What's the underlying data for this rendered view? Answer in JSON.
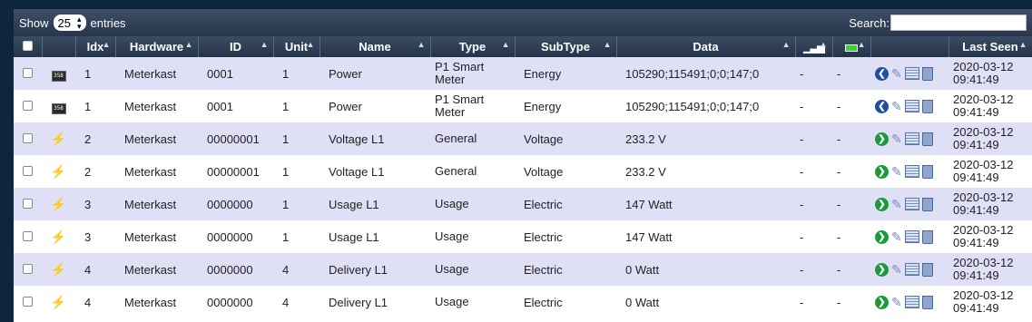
{
  "toolbar": {
    "show_label": "Show",
    "entries_value": "25",
    "entries_label": "entries",
    "search_label": "Search:",
    "search_value": ""
  },
  "columns": {
    "idx": "Idx",
    "hardware": "Hardware",
    "id": "ID",
    "unit": "Unit",
    "name": "Name",
    "type": "Type",
    "subtype": "SubType",
    "data": "Data",
    "last_seen": "Last Seen",
    "signal_icon": "signal-icon",
    "battery_icon": "battery-icon",
    "sort_glyph": "▲"
  },
  "rows": [
    {
      "icon": "meter",
      "idx": "1",
      "hardware": "Meterkast",
      "id": "0001",
      "unit": "1",
      "name": "Power",
      "type": "P1 Smart Meter",
      "subtype": "Energy",
      "data": "105290;115491;0;0;147;0",
      "signal": "-",
      "battery": "-",
      "last_seen": "2020-03-12 09:41:49",
      "arrow": "blue"
    },
    {
      "icon": "meter",
      "idx": "1",
      "hardware": "Meterkast",
      "id": "0001",
      "unit": "1",
      "name": "Power",
      "type": "P1 Smart Meter",
      "subtype": "Energy",
      "data": "105290;115491;0;0;147;0",
      "signal": "-",
      "battery": "-",
      "last_seen": "2020-03-12 09:41:49",
      "arrow": "blue"
    },
    {
      "icon": "bolt",
      "idx": "2",
      "hardware": "Meterkast",
      "id": "00000001",
      "unit": "1",
      "name": "Voltage L1",
      "type": "General",
      "subtype": "Voltage",
      "data": "233.2 V",
      "signal": "-",
      "battery": "-",
      "last_seen": "2020-03-12 09:41:49",
      "arrow": "green"
    },
    {
      "icon": "bolt",
      "idx": "2",
      "hardware": "Meterkast",
      "id": "00000001",
      "unit": "1",
      "name": "Voltage L1",
      "type": "General",
      "subtype": "Voltage",
      "data": "233.2 V",
      "signal": "-",
      "battery": "-",
      "last_seen": "2020-03-12 09:41:49",
      "arrow": "green"
    },
    {
      "icon": "bolt",
      "idx": "3",
      "hardware": "Meterkast",
      "id": "0000000",
      "unit": "1",
      "name": "Usage L1",
      "type": "Usage",
      "subtype": "Electric",
      "data": "147 Watt",
      "signal": "-",
      "battery": "-",
      "last_seen": "2020-03-12 09:41:49",
      "arrow": "green"
    },
    {
      "icon": "bolt",
      "idx": "3",
      "hardware": "Meterkast",
      "id": "0000000",
      "unit": "1",
      "name": "Usage L1",
      "type": "Usage",
      "subtype": "Electric",
      "data": "147 Watt",
      "signal": "-",
      "battery": "-",
      "last_seen": "2020-03-12 09:41:49",
      "arrow": "green"
    },
    {
      "icon": "bolt",
      "idx": "4",
      "hardware": "Meterkast",
      "id": "0000000",
      "unit": "4",
      "name": "Delivery L1",
      "type": "Usage",
      "subtype": "Electric",
      "data": "0 Watt",
      "signal": "-",
      "battery": "-",
      "last_seen": "2020-03-12 09:41:49",
      "arrow": "green"
    },
    {
      "icon": "bolt",
      "idx": "4",
      "hardware": "Meterkast",
      "id": "0000000",
      "unit": "4",
      "name": "Delivery L1",
      "type": "Usage",
      "subtype": "Electric",
      "data": "0 Watt",
      "signal": "-",
      "battery": "-",
      "last_seen": "2020-03-12 09:41:49",
      "arrow": "green"
    }
  ],
  "icons": {
    "meter_text": "358",
    "bolt": "⚡",
    "arrow_blue": "❮",
    "arrow_green": "❯",
    "edit": "✎",
    "signal": "📶"
  },
  "colors": {
    "header_bg": "#26364c",
    "row_odd": "#dfe0f5",
    "row_even": "#ffffff",
    "arrow_blue": "#1f4fa0",
    "arrow_green": "#1a9a3a"
  }
}
